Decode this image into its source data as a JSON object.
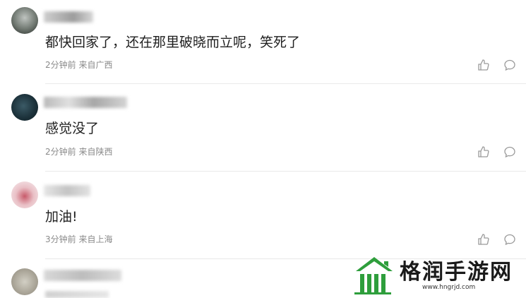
{
  "comments": [
    {
      "text": "都快回家了，还在那里破晓而立呢，笑死了",
      "meta": "2分钟前 来自广西"
    },
    {
      "text": "感觉没了",
      "meta": "2分钟前 来自陕西"
    },
    {
      "text": "加油!",
      "meta": "3分钟前 来自上海"
    }
  ],
  "icons": {
    "like": "thumbs-up-icon",
    "reply": "comment-bubble-icon"
  },
  "watermark": {
    "title": "格润手游网",
    "url": "www.hngrjd.com"
  },
  "colors": {
    "meta_text": "#8a8a8a",
    "icon": "#9a9a9a",
    "brand_green": "#2e9e3c"
  }
}
